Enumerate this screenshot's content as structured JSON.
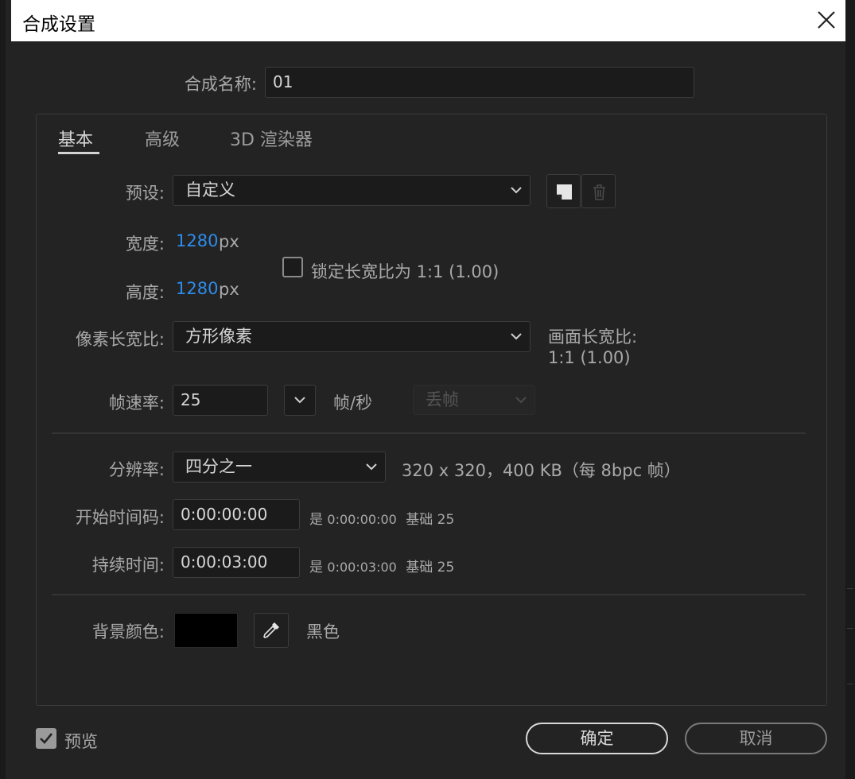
{
  "dialog": {
    "title": "合成设置"
  },
  "comp_name": {
    "label": "合成名称:",
    "value": "01"
  },
  "tabs": [
    {
      "label": "基本",
      "active": true
    },
    {
      "label": "高级",
      "active": false
    },
    {
      "label": "3D 渲染器",
      "active": false
    }
  ],
  "preset": {
    "label": "预设:",
    "value": "自定义"
  },
  "width": {
    "label": "宽度:",
    "value": "1280",
    "unit": "px"
  },
  "height": {
    "label": "高度:",
    "value": "1280",
    "unit": "px"
  },
  "lock_aspect": {
    "label": "锁定长宽比为 1:1 (1.00)",
    "checked": false
  },
  "pixel_aspect": {
    "label": "像素长宽比:",
    "value": "方形像素"
  },
  "frame_aspect": {
    "label": "画面长宽比:",
    "value": "1:1 (1.00)"
  },
  "frame_rate": {
    "label": "帧速率:",
    "value": "25",
    "unit": "帧/秒",
    "drop_frame": "丢帧"
  },
  "resolution": {
    "label": "分辨率:",
    "value": "四分之一",
    "info": "320 x 320，400 KB（每 8bpc 帧）"
  },
  "start_timecode": {
    "label": "开始时间码:",
    "value": "0:00:00:00",
    "info_prefix": "是",
    "info_value": "0:00:00:00",
    "info_base": "基础 25"
  },
  "duration": {
    "label": "持续时间:",
    "value": "0:00:03:00",
    "info_prefix": "是",
    "info_value": "0:00:03:00",
    "info_base": "基础 25"
  },
  "background": {
    "label": "背景颜色:",
    "color": "#000000",
    "name": "黑色"
  },
  "preview": {
    "label": "预览",
    "checked": true
  },
  "buttons": {
    "ok": "确定",
    "cancel": "取消"
  },
  "colors": {
    "accent_blue": "#2d8ceb",
    "panel_bg": "#232323",
    "field_bg": "#1b1b1b"
  },
  "icons": [
    "close-icon",
    "chevron-down-icon",
    "save-preset-icon",
    "trash-icon",
    "eyedropper-icon",
    "checkmark-icon"
  ]
}
